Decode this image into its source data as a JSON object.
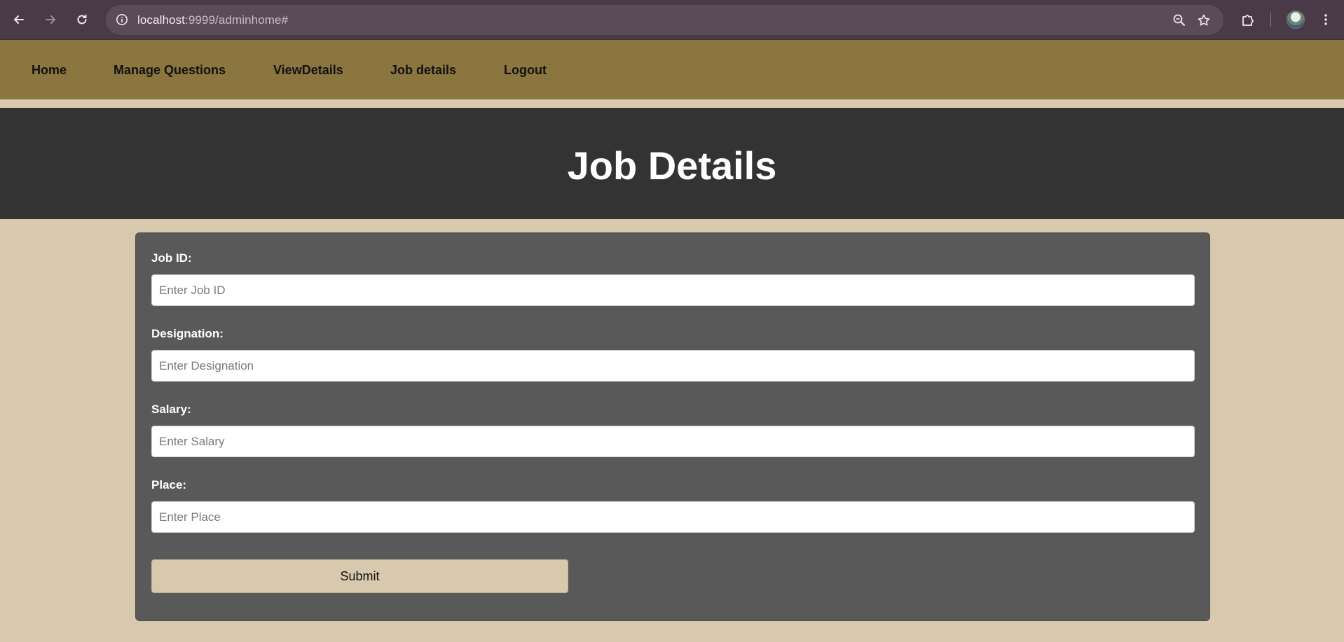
{
  "browser": {
    "url_host": "localhost",
    "url_rest": ":9999/adminhome#"
  },
  "nav": {
    "items": [
      {
        "label": "Home"
      },
      {
        "label": "Manage Questions"
      },
      {
        "label": "ViewDetails"
      },
      {
        "label": "Job details"
      },
      {
        "label": "Logout"
      }
    ]
  },
  "header": {
    "title": "Job Details"
  },
  "form": {
    "fields": [
      {
        "label": "Job ID:",
        "placeholder": "Enter Job ID",
        "value": ""
      },
      {
        "label": "Designation:",
        "placeholder": "Enter Designation",
        "value": ""
      },
      {
        "label": "Salary:",
        "placeholder": "Enter Salary",
        "value": ""
      },
      {
        "label": "Place:",
        "placeholder": "Enter Place",
        "value": ""
      }
    ],
    "submit_label": "Submit"
  },
  "colors": {
    "nav_bg": "#8b7640",
    "header_bg": "#333333",
    "card_bg": "#595959",
    "page_bg": "#d8c8ad"
  }
}
